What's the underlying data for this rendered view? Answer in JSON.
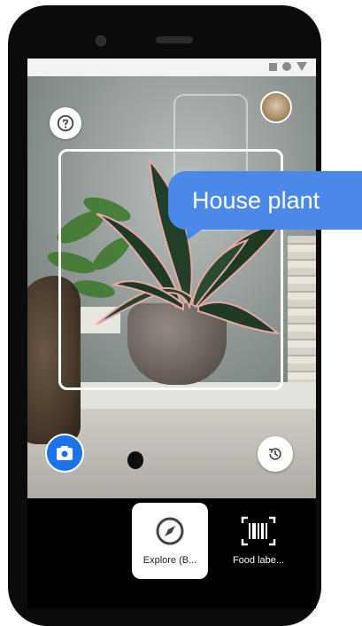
{
  "colors": {
    "accent": "#1a73e8",
    "callout_bg": "#4a89e8",
    "phone_body": "#0b0b0b",
    "frame": "#ffffff"
  },
  "status_bar": {
    "icons": [
      "square-icon",
      "circle-icon",
      "triangle-icon"
    ]
  },
  "top_controls": {
    "help_icon": "help-icon",
    "avatar_icon": "avatar-icon"
  },
  "recognition": {
    "label": "House plant"
  },
  "bottom_controls": {
    "gallery_icon": "camera-gallery-icon",
    "history_icon": "history-icon"
  },
  "modes": [
    {
      "label": "Explore (B...",
      "icon": "compass-icon",
      "selected": true
    },
    {
      "label": "Food labe...",
      "icon": "barcode-icon",
      "selected": false
    }
  ]
}
